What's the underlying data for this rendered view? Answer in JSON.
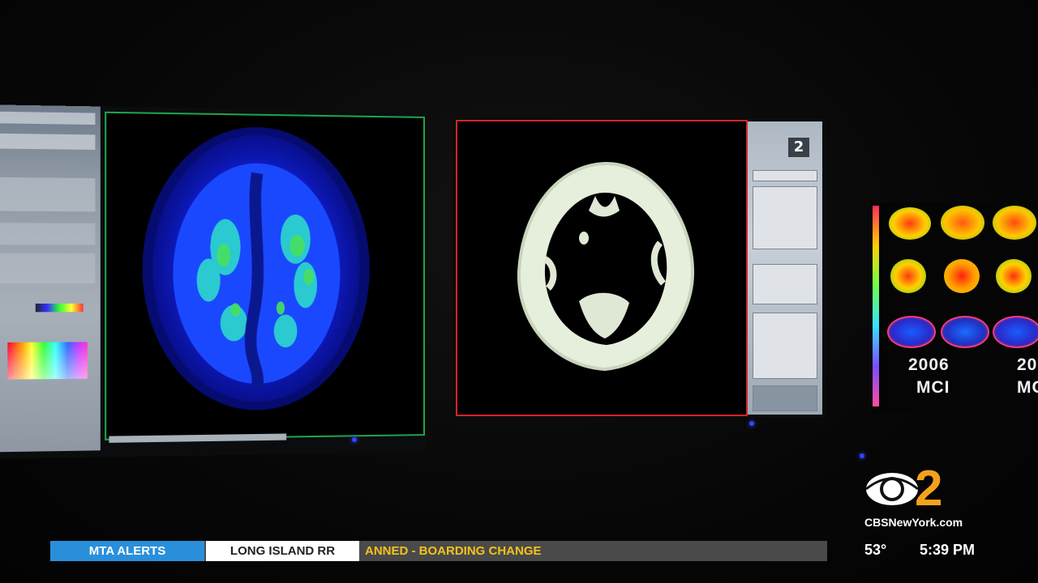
{
  "monitors": {
    "ct": {
      "badge": "2"
    },
    "maps": {
      "year": "2006",
      "year_partial": "20",
      "diagnosis": "MCI",
      "diagnosis_partial": "MC"
    }
  },
  "ticker": {
    "label": "MTA ALERTS",
    "sublabel": "LONG ISLAND RR",
    "text": "ANNED - BOARDING CHANGE"
  },
  "station": {
    "domain": "CBSNewYork.com",
    "channel": "2"
  },
  "weather": {
    "temp": "53°"
  },
  "clock": {
    "time": "5:39 PM"
  },
  "colors": {
    "ticker_blue": "#2a8fdb",
    "ticker_text": "#f4c21c",
    "pet_frame": "#1fa34a",
    "ct_frame": "#d3252a"
  }
}
